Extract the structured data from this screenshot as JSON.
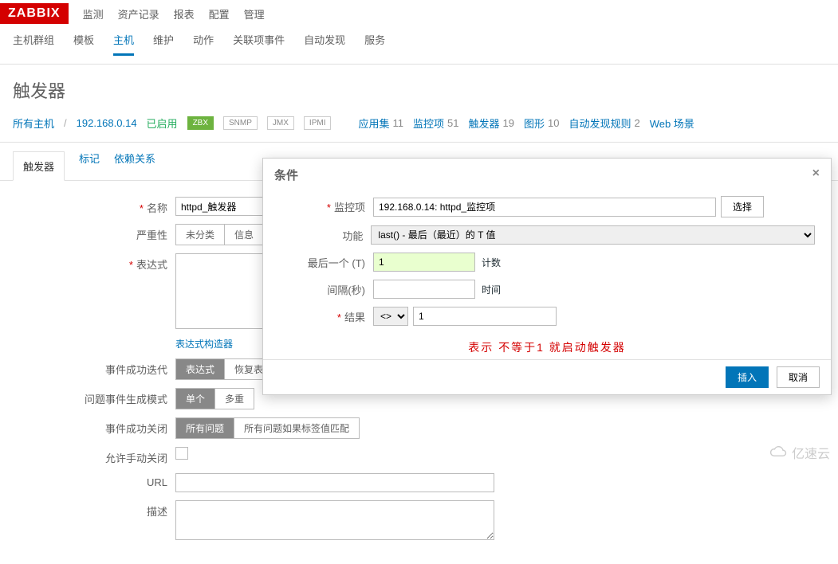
{
  "brand": "ZABBIX",
  "topnav": [
    "监测",
    "资产记录",
    "报表",
    "配置",
    "管理"
  ],
  "subnav": [
    "主机群组",
    "模板",
    "主机",
    "维护",
    "动作",
    "关联项事件",
    "自动发现",
    "服务"
  ],
  "subnav_active": "主机",
  "page_title": "触发器",
  "breadcrumb": {
    "all_hosts": "所有主机",
    "host": "192.168.0.14",
    "status": "已启用",
    "badges": [
      "ZBX",
      "SNMP",
      "JMX",
      "IPMI"
    ]
  },
  "counts": [
    {
      "label": "应用集",
      "val": "11"
    },
    {
      "label": "监控项",
      "val": "51"
    },
    {
      "label": "触发器",
      "val": "19"
    },
    {
      "label": "图形",
      "val": "10"
    },
    {
      "label": "自动发现规则",
      "val": "2"
    },
    {
      "label": "Web 场景",
      "val": ""
    }
  ],
  "tabs": [
    "触发器",
    "标记",
    "依赖关系"
  ],
  "tabs_active": "触发器",
  "form": {
    "name_label": "名称",
    "name_value": "httpd_触发器",
    "severity_label": "严重性",
    "severity_opts": [
      "未分类",
      "信息"
    ],
    "expr_label": "表达式",
    "expr_builder": "表达式构造器",
    "event_ok_gen_label": "事件成功迭代",
    "event_ok_gen_opts": [
      "表达式",
      "恢复表"
    ],
    "problem_event_mode_label": "问题事件生成模式",
    "problem_event_mode_opts": [
      "单个",
      "多重"
    ],
    "event_ok_close_label": "事件成功关闭",
    "event_ok_close_opts": [
      "所有问题",
      "所有问题如果标签值匹配"
    ],
    "allow_manual_close_label": "允许手动关闭",
    "url_label": "URL",
    "desc_label": "描述"
  },
  "modal": {
    "title": "条件",
    "item_label": "监控项",
    "item_value": "192.168.0.14: httpd_监控项",
    "select_btn": "选择",
    "func_label": "功能",
    "func_value": "last() - 最后（最近）的 T 值",
    "last_of_label": "最后一个 (T)",
    "last_of_value": "1",
    "last_of_unit": "计数",
    "interval_label": "间隔(秒)",
    "interval_value": "",
    "interval_unit": "时间",
    "result_label": "结果",
    "result_op": "<>",
    "result_value": "1",
    "note": "表示 不等于1 就启动触发器",
    "insert_btn": "插入",
    "cancel_btn": "取消"
  },
  "watermark": "亿速云"
}
